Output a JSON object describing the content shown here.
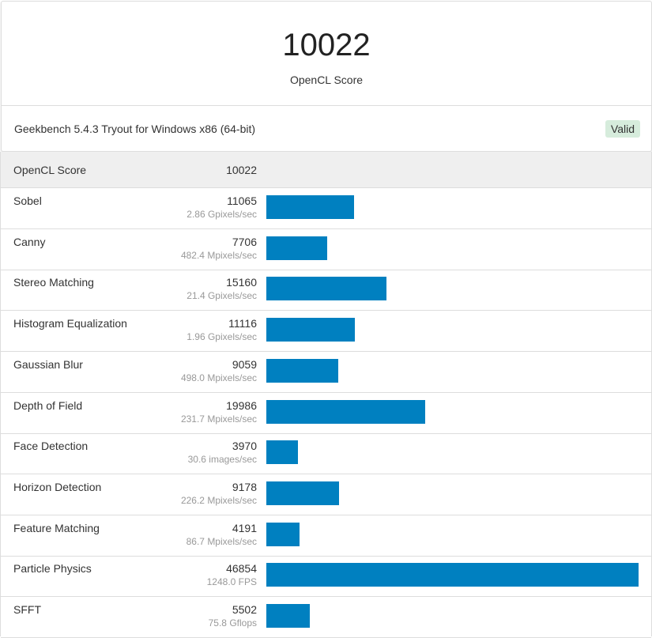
{
  "header": {
    "score": "10022",
    "score_label": "OpenCL Score",
    "platform": "Geekbench 5.4.3 Tryout for Windows x86 (64-bit)",
    "status_badge": "Valid"
  },
  "table": {
    "head": {
      "name": "OpenCL Score",
      "score": "10022"
    }
  },
  "colors": {
    "bar": "#0080c0",
    "valid_badge_bg": "#d6ecdc"
  },
  "chart_data": {
    "type": "bar",
    "orientation": "horizontal",
    "title": "OpenCL Score",
    "categories": [
      "Sobel",
      "Canny",
      "Stereo Matching",
      "Histogram Equalization",
      "Gaussian Blur",
      "Depth of Field",
      "Face Detection",
      "Horizon Detection",
      "Feature Matching",
      "Particle Physics",
      "SFFT"
    ],
    "values": [
      11065,
      7706,
      15160,
      11116,
      9059,
      19986,
      3970,
      9178,
      4191,
      46854,
      5502
    ],
    "units": [
      "2.86 Gpixels/sec",
      "482.4 Mpixels/sec",
      "21.4 Gpixels/sec",
      "1.96 Gpixels/sec",
      "498.0 Mpixels/sec",
      "231.7 Mpixels/sec",
      "30.6 images/sec",
      "226.2 Mpixels/sec",
      "86.7 Mpixels/sec",
      "1248.0 FPS",
      "75.8 Gflops"
    ],
    "xlim": [
      0,
      46854
    ],
    "grid": false,
    "legend": "none"
  }
}
